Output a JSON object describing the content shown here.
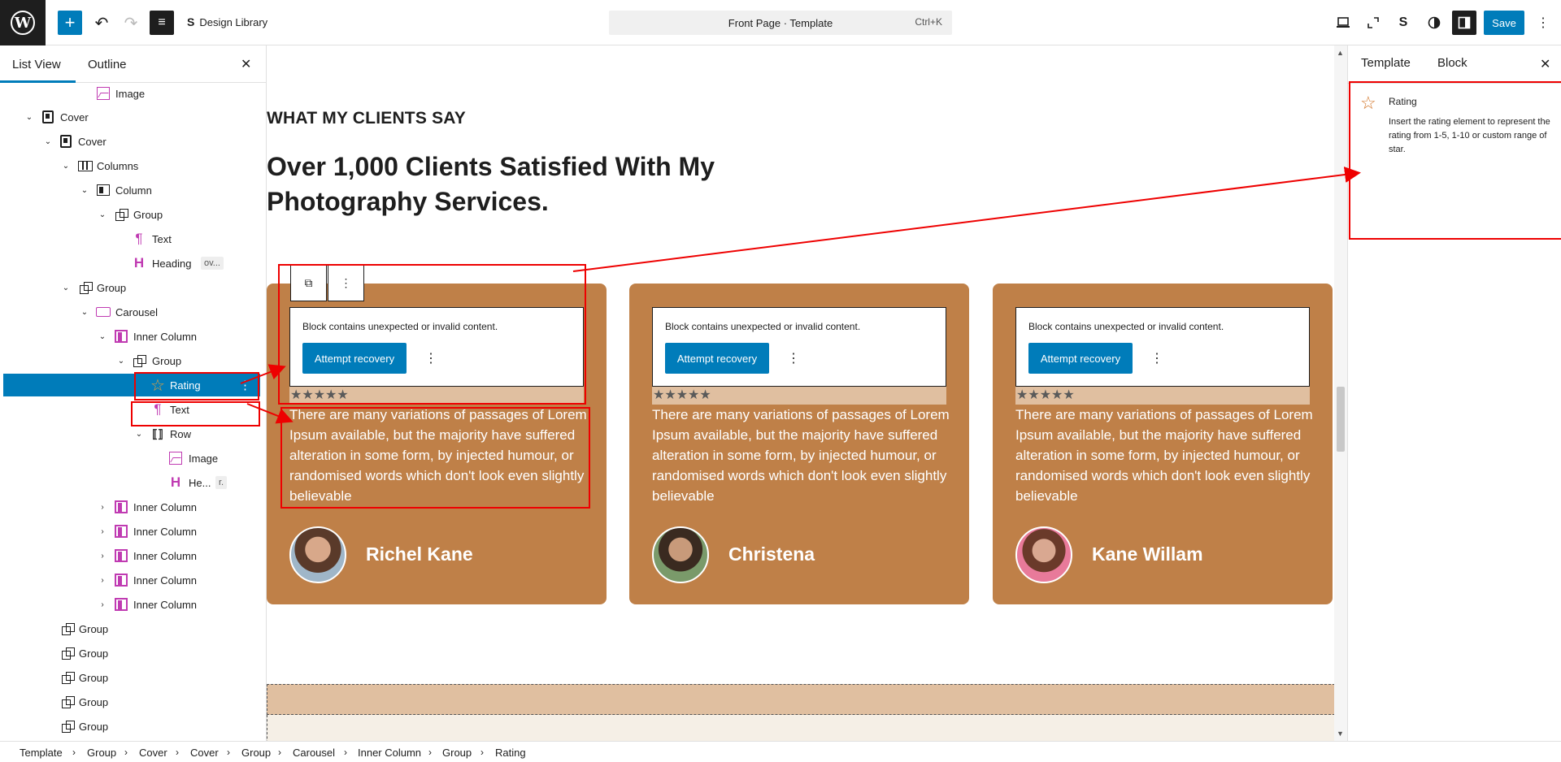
{
  "topbar": {
    "logo": "W",
    "add_icon": "+",
    "undo_icon": "↶",
    "redo_icon": "↷",
    "listview_icon": "≡",
    "design_library_label": "Design Library",
    "command_title": "Front Page · Template",
    "command_shortcut": "Ctrl+K",
    "save_label": "Save",
    "more_icon": "⋮"
  },
  "left_panel": {
    "tab_list_view": "List View",
    "tab_outline": "Outline",
    "close_icon": "✕",
    "items": [
      {
        "label": "Image",
        "chevron": "",
        "tag": ""
      },
      {
        "label": "Cover",
        "chevron": "⌄",
        "tag": ""
      },
      {
        "label": "Cover",
        "chevron": "⌄",
        "tag": ""
      },
      {
        "label": "Columns",
        "chevron": "⌄",
        "tag": ""
      },
      {
        "label": "Column",
        "chevron": "⌄",
        "tag": ""
      },
      {
        "label": "Group",
        "chevron": "⌄",
        "tag": ""
      },
      {
        "label": "Text",
        "chevron": "",
        "tag": ""
      },
      {
        "label": "Heading",
        "chevron": "",
        "tag": "ov..."
      },
      {
        "label": "Group",
        "chevron": "⌄",
        "tag": ""
      },
      {
        "label": "Carousel",
        "chevron": "⌄",
        "tag": ""
      },
      {
        "label": "Inner Column",
        "chevron": "⌄",
        "tag": ""
      },
      {
        "label": "Group",
        "chevron": "⌄",
        "tag": ""
      },
      {
        "label": "Rating",
        "chevron": "",
        "tag": ""
      },
      {
        "label": "Text",
        "chevron": "",
        "tag": ""
      },
      {
        "label": "Row",
        "chevron": "⌄",
        "tag": ""
      },
      {
        "label": "Image",
        "chevron": "",
        "tag": ""
      },
      {
        "label": "He...",
        "chevron": "",
        "tag": "r."
      },
      {
        "label": "Inner Column",
        "chevron": "›",
        "tag": ""
      },
      {
        "label": "Inner Column",
        "chevron": "›",
        "tag": ""
      },
      {
        "label": "Inner Column",
        "chevron": "›",
        "tag": ""
      },
      {
        "label": "Inner Column",
        "chevron": "›",
        "tag": ""
      },
      {
        "label": "Inner Column",
        "chevron": "›",
        "tag": ""
      },
      {
        "label": "Group",
        "chevron": "",
        "tag": ""
      },
      {
        "label": "Group",
        "chevron": "",
        "tag": ""
      },
      {
        "label": "Group",
        "chevron": "",
        "tag": ""
      },
      {
        "label": "Group",
        "chevron": "",
        "tag": ""
      },
      {
        "label": "Group",
        "chevron": "",
        "tag": ""
      }
    ],
    "rating_more_icon": "⋮"
  },
  "canvas": {
    "eyebrow": "WHAT MY CLIENTS SAY",
    "heading": "Over 1,000 Clients Satisfied With My Photography Services.",
    "invalid_message": "Block contains unexpected or invalid content.",
    "recover_label": "Attempt recovery",
    "kebab": "⋮",
    "stars": "★★★★★",
    "testimonial_text": "There are many variations of passages of Lorem Ipsum available, but the majority have suffered alteration in some form, by injected humour, or randomised words which don't look even slightly believable",
    "cards": [
      {
        "name": "Richel Kane"
      },
      {
        "name": "Christena"
      },
      {
        "name": "Kane Willam"
      }
    ],
    "toolbar_copy_icon": "⧉",
    "toolbar_more_icon": "⋮"
  },
  "right_panel": {
    "tab_template": "Template",
    "tab_block": "Block",
    "close_icon": "✕",
    "block_icon": "☆",
    "block_title": "Rating",
    "block_description": "Insert the rating element to represent the rating from 1-5, 1-10 or custom range of star."
  },
  "breadcrumb": [
    "Template",
    "Group",
    "Cover",
    "Cover",
    "Group",
    "Carousel",
    "Inner Column",
    "Group",
    "Rating"
  ],
  "colors": {
    "accent": "#007cba",
    "card": "#bf8048",
    "annotation": "#e00000",
    "rating_icon": "#d3782d"
  }
}
